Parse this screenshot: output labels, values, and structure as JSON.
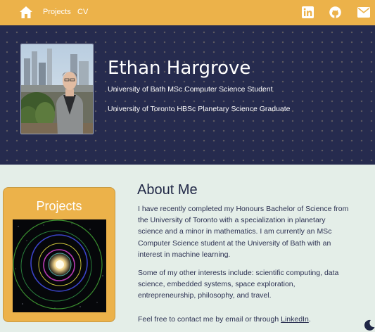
{
  "nav": {
    "home_icon": "home-icon",
    "links": {
      "projects": "Projects",
      "cv": "CV"
    },
    "icons": [
      "linkedin-icon",
      "github-icon",
      "email-icon"
    ]
  },
  "hero": {
    "name": "Ethan Hargrove",
    "line1": "University of Bath MSc Computer Science Student",
    "line2": "University of Toronto HBSc Planetary Science Graduate"
  },
  "projects_card": {
    "title": "Projects"
  },
  "about": {
    "title": "About Me",
    "p1": "I have recently completed my Honours Bachelor of Science from the University of Toronto with a specialization in planetary science and a minor in mathematics. I am currently an MSc Computer Science student at the University of Bath with an interest in machine learning.",
    "p2": "Some of my other interests include: scientific computing, data science, embedded systems, space exploration, entrepreneurship, philosophy, and travel.",
    "p3_prefix": "Feel free to contact me by email or through ",
    "p3_link": "LinkedIn",
    "p3_suffix": "."
  },
  "theme_toggle": "moon-icon",
  "colors": {
    "accent": "#ecb24a",
    "hero_bg": "#262b4e",
    "page_bg": "#e4eee8",
    "text": "#2c3152"
  }
}
